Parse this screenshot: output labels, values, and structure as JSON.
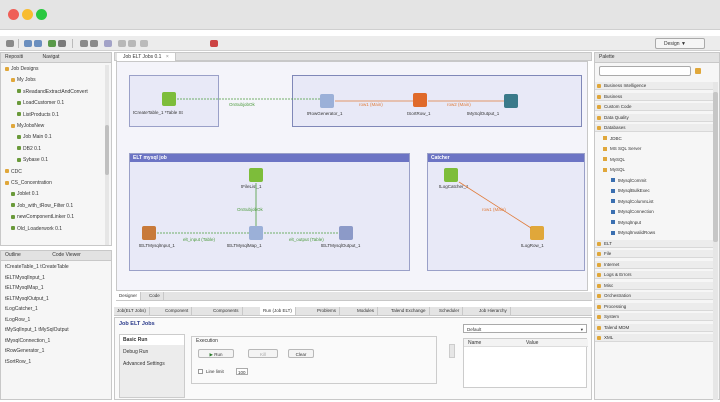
{
  "colors": {
    "accent": "#6c74c4",
    "link_orange": "#e07b39",
    "link_green": "#4a9a3a",
    "subjob_bg": "#e8e9f7"
  },
  "toolbar": {
    "perspective_label": "Design ▼"
  },
  "repository": {
    "title": "Repositi",
    "tab2": "Navigat",
    "items": [
      "Job Designs",
      "My Jobs",
      "sReadandExtractAndConvert",
      "LoadCustomer 0.1",
      "ListProducts 0.1",
      "MyJobsNew",
      "Job Main 0.1",
      "DB2 0.1",
      "Sybase 0.1",
      "CDC",
      "CS_Concentration",
      "Joblet 0.1",
      "Job_with_tRow_Filter 0.1",
      "newComponentLinker 0.1",
      "Old_Loaderwork 0.1"
    ]
  },
  "outline": {
    "title": "Outline",
    "tab2": "Code Viewer",
    "items": [
      "tCreateTable_1 tCreateTable",
      "tELTMysqlInput_1",
      "tELTMysqlMap_1",
      "tELTMysqlOutput_1",
      "tLogCatcher_1",
      "tLogRow_1",
      "tMySqlInput_1 tMySqlOutput",
      "tMysqlConnection_1",
      "tRowGenerator_1",
      "tSortRow_1"
    ]
  },
  "editor": {
    "tab_label": "Job ELT Jobs 0.1",
    "close": "×"
  },
  "canvas": {
    "subjob1_components": [
      "tCreateTable_1 *Table St",
      "tRowGenerator_1",
      "tSortRow_1",
      "tMySqlOutput_1"
    ],
    "subjob1_links": [
      "OnSubjobOk",
      "row1 (Main)",
      "row2 (Main)"
    ],
    "subjob2_title": "ELT mysql job",
    "subjob2_components": [
      "tFileList_1",
      "tELTMysqlInput_1",
      "tELTMysqlMap_1",
      "tELTMysqlOutput_1"
    ],
    "subjob2_links": [
      "OnSubjobOk",
      "elt_input (Table)",
      "elt_output (Table)"
    ],
    "subjob3_title": "Catcher",
    "subjob3_components": [
      "tLogCatcher_1",
      "tLogRow_1"
    ],
    "subjob3_links": [
      "row1 (Main)"
    ]
  },
  "editor_tabs": [
    "Designer",
    "Code"
  ],
  "bottom_tabs": [
    "Job(ELT Jobs)",
    "Component",
    "Components",
    "Run (Job ELT)",
    "Problems",
    "Modules",
    "Talend Exchange",
    "Scheduler",
    "Job Hierarchy"
  ],
  "run_panel": {
    "title": "Job ELT Jobs",
    "side_items": [
      "Basic Run",
      "Debug Run",
      "Advanced Settings"
    ],
    "execution_label": "Execution",
    "run_button": "Run",
    "kill_button": "Kill",
    "clear_button": "Clear",
    "line_limit_label": "Line limit",
    "line_limit_value": "100",
    "context_value": "Default",
    "context_cols": [
      "Name",
      "Value"
    ]
  },
  "palette": {
    "title": "Palette",
    "search_placeholder": "",
    "categories_top": [
      "Business Intelligence",
      "Business",
      "Custom Code",
      "Data Quality",
      "Databases"
    ],
    "db_items": [
      "JDBC",
      "MS SQL Server",
      "MySQL",
      "MySQL"
    ],
    "mysql_items": [
      "tMysqlCommit",
      "tMysqlBulkExec",
      "tMysqlColumnList",
      "tMysqlConnection",
      "tMysqlInput",
      "tMysqlInvalidRows"
    ],
    "categories_bottom": [
      "ELT",
      "File",
      "Internet",
      "Logs & Errors",
      "Misc",
      "Orchestration",
      "Processing",
      "System",
      "Talend MDM",
      "XML"
    ]
  }
}
